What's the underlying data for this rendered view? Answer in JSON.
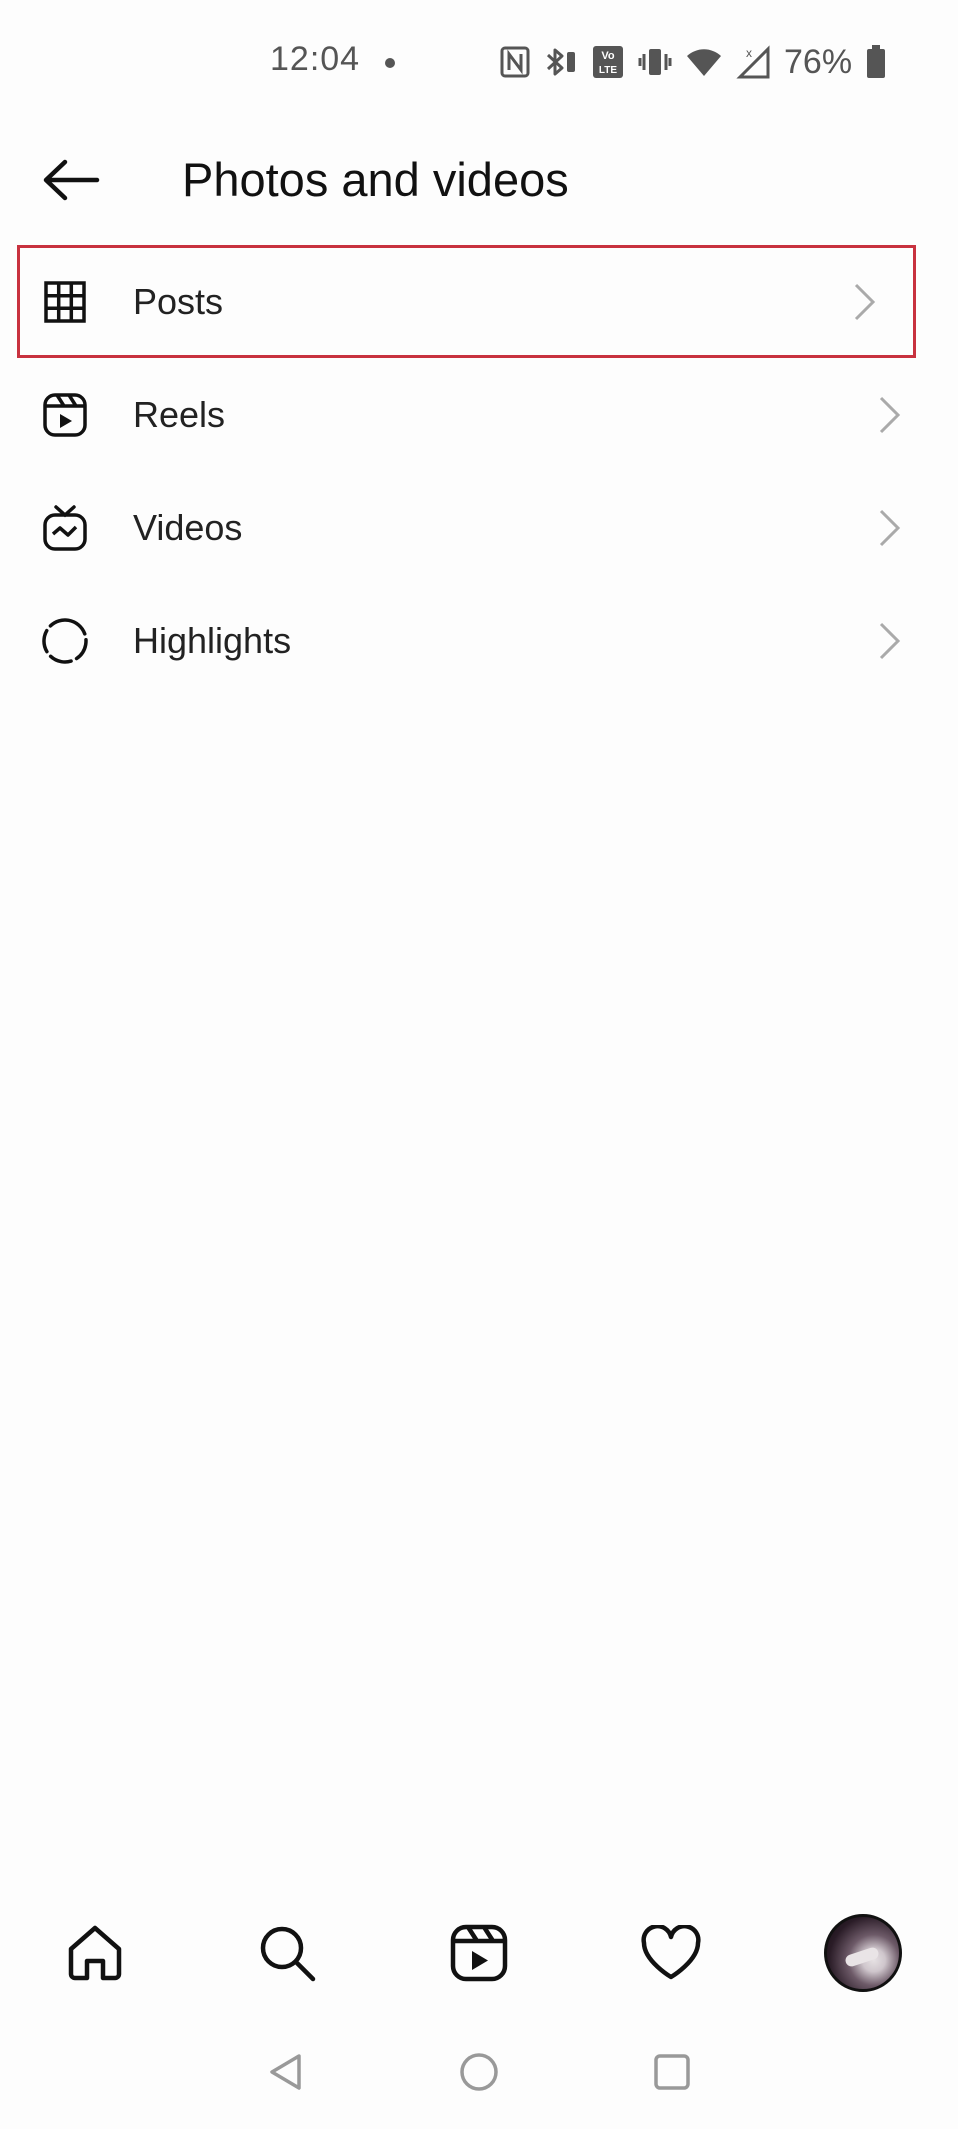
{
  "status_bar": {
    "time": "12:04",
    "battery": "76%",
    "icons": [
      "nfc-icon",
      "bluetooth-icon",
      "volte-icon",
      "vibrate-icon",
      "wifi-icon",
      "signal-icon",
      "battery-icon"
    ]
  },
  "header": {
    "back_icon": "arrow-left-icon",
    "title": "Photos and videos"
  },
  "menu": {
    "items": [
      {
        "label": "Posts",
        "icon": "grid-icon",
        "highlighted": true
      },
      {
        "label": "Reels",
        "icon": "reels-icon",
        "highlighted": false
      },
      {
        "label": "Videos",
        "icon": "igtv-icon",
        "highlighted": false
      },
      {
        "label": "Highlights",
        "icon": "highlights-icon",
        "highlighted": false
      }
    ],
    "highlight_color": "#c8323f"
  },
  "bottom_nav": {
    "items": [
      "home-icon",
      "search-icon",
      "reels-icon",
      "heart-icon",
      "profile-avatar"
    ]
  },
  "system_nav": {
    "items": [
      "back-triangle-icon",
      "home-circle-icon",
      "recents-square-icon"
    ]
  }
}
